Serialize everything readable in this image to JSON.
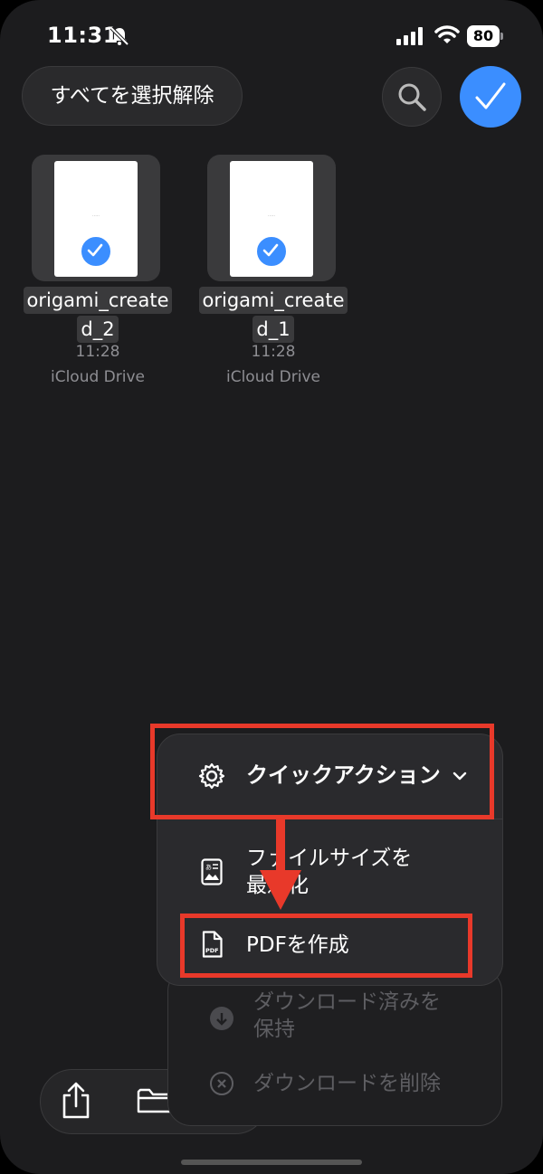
{
  "status_bar": {
    "time": "11:31",
    "battery": "80"
  },
  "header": {
    "deselect_all_label": "すべてを選択解除"
  },
  "files": [
    {
      "name_line1": "origami_create",
      "name_line2": "d_2",
      "time": "11:28",
      "location": "iCloud Drive"
    },
    {
      "name_line1": "origami_create",
      "name_line2": "d_1",
      "time": "11:28",
      "location": "iCloud Drive"
    }
  ],
  "quick_actions_menu": {
    "title": "クイックアクション",
    "items": [
      {
        "label_line1": "ファイルサイズを",
        "label_line2": "最適化",
        "icon": "image-size-icon"
      },
      {
        "label": "PDFを作成",
        "icon": "pdf-document-icon"
      }
    ]
  },
  "actions_menu": {
    "items": [
      {
        "label_line1": "ダウンロード済みを",
        "label_line2": "保持",
        "icon": "download-icon"
      },
      {
        "label": "ダウンロードを削除",
        "icon": "remove-download-icon"
      }
    ]
  },
  "colors": {
    "accent": "#3b8eff",
    "highlight": "#e8392a",
    "background": "#1c1c1e"
  }
}
